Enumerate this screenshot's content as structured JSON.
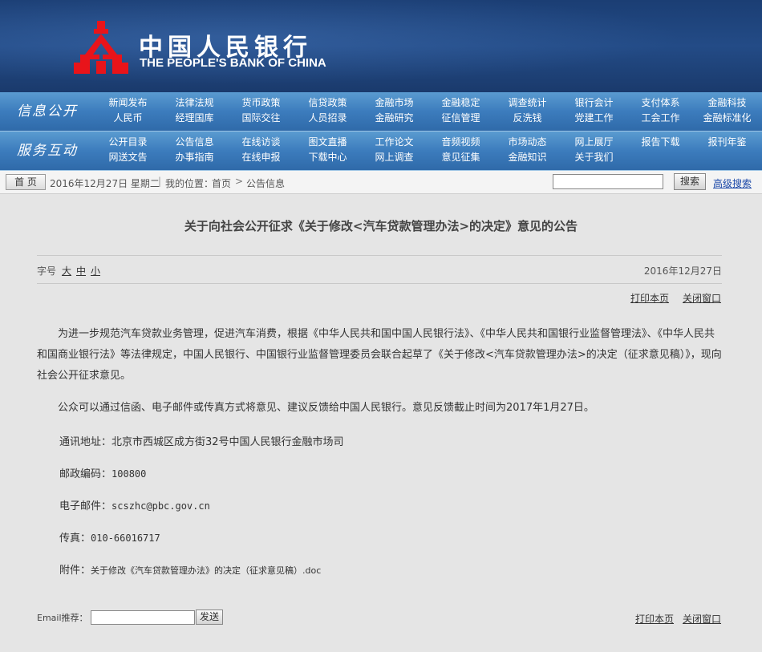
{
  "header": {
    "title_cn": "中国人民银行",
    "title_en": "THE PEOPLE'S BANK OF CHINA",
    "logo_color": "#e8141a"
  },
  "nav_info": {
    "title": "信息公开",
    "row1": [
      "新闻发布",
      "法律法规",
      "货币政策",
      "信贷政策",
      "金融市场",
      "金融稳定",
      "调查统计",
      "银行会计",
      "支付体系",
      "金融科技"
    ],
    "row2": [
      "人民币",
      "经理国库",
      "国际交往",
      "人员招录",
      "金融研究",
      "征信管理",
      "反洗钱",
      "党建工作",
      "工会工作",
      "金融标准化"
    ]
  },
  "nav_service": {
    "title": "服务互动",
    "row1": [
      "公开目录",
      "公告信息",
      "在线访谈",
      "图文直播",
      "工作论文",
      "音频视频",
      "市场动态",
      "网上展厅",
      "报告下载",
      "报刊年鉴"
    ],
    "row2": [
      "网送文告",
      "办事指南",
      "在线申报",
      "下载中心",
      "网上调查",
      "意见征集",
      "金融知识",
      "关于我们"
    ]
  },
  "crumb": {
    "home": "首 页",
    "date": "2016年12月27日  星期二",
    "sep": "|",
    "location_label": "我的位置：",
    "location_home": "首页",
    "gt": ">",
    "location_page": "公告信息",
    "search_value": "",
    "search_button": "搜索",
    "advanced_search": "高级搜索"
  },
  "article": {
    "title": "关于向社会公开征求《关于修改<汽车贷款管理办法>的决定》意见的公告",
    "font_label": "字号",
    "font_large": "大",
    "font_medium": "中",
    "font_small": "小",
    "date": "2016年12月27日",
    "print": "打印本页",
    "close": "关闭窗口",
    "para1": "为进一步规范汽车贷款业务管理，促进汽车消费，根据《中华人民共和国中国人民银行法》、《中华人民共和国银行业监督管理法》、《中华人民共和国商业银行法》等法律规定，中国人民银行、中国银行业监督管理委员会联合起草了《关于修改<汽车贷款管理办法>的决定（征求意见稿）》，现向社会公开征求意见。",
    "para2": "公众可以通过信函、电子邮件或传真方式将意见、建议反馈给中国人民银行。意见反馈截止时间为2017年1月27日。",
    "address_label": "通讯地址：",
    "address": "北京市西城区成方街32号中国人民银行金融市场司",
    "postcode_label": "邮政编码：",
    "postcode": "100800",
    "email_label": "电子邮件：",
    "email": "scszhc@pbc.gov.cn",
    "fax_label": "传真：",
    "fax": "010-66016717",
    "attachment_label": "附件：",
    "attachment": "关于修改《汽车贷款管理办法》的决定（征求意见稿）.doc"
  },
  "footer": {
    "email_label": "Email推荐：",
    "email_value": "",
    "send": "发送",
    "print": "打印本页",
    "close": "关闭窗口"
  }
}
